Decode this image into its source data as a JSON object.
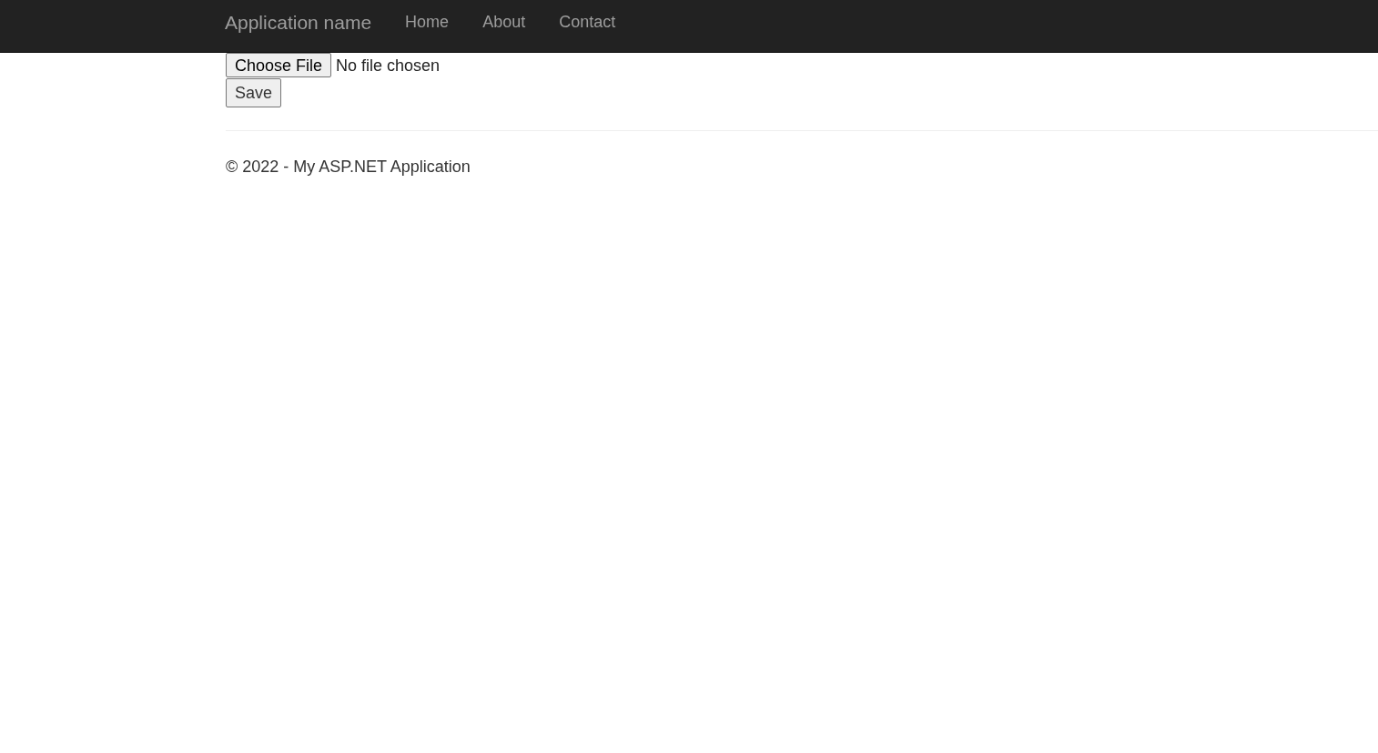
{
  "navbar": {
    "brand": "Application name",
    "links": [
      "Home",
      "About",
      "Contact"
    ]
  },
  "form": {
    "file_button": "Choose File",
    "file_status": "No file chosen",
    "save_button": "Save"
  },
  "footer": {
    "text": "© 2022 - My ASP.NET Application"
  }
}
